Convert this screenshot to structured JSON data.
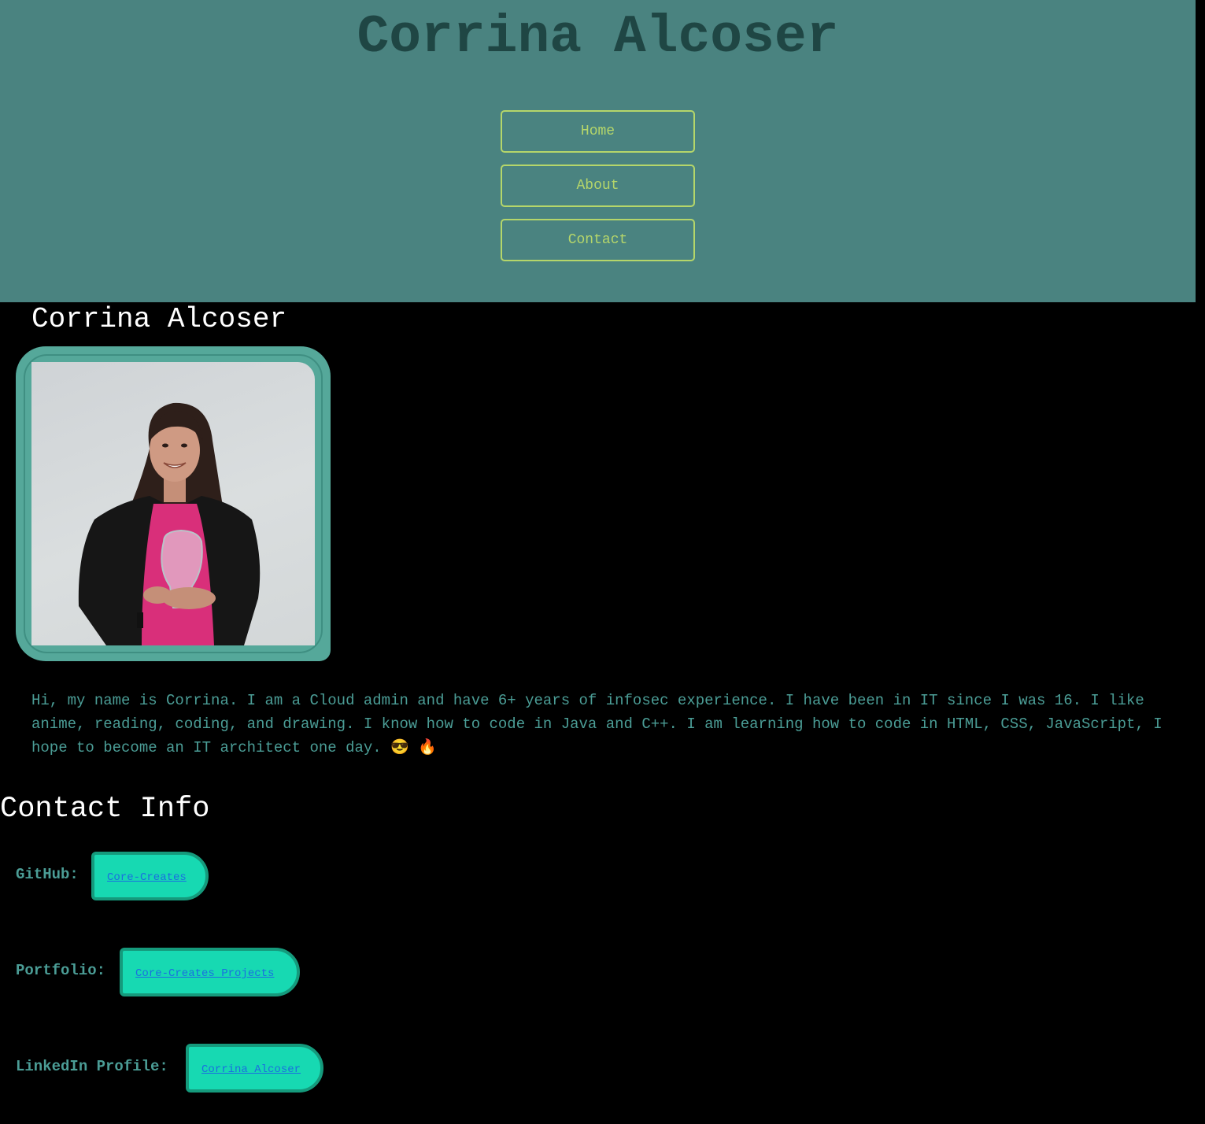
{
  "header": {
    "title": "Corrina Alcoser",
    "nav": {
      "home": "Home",
      "about": "About",
      "contact": "Contact"
    }
  },
  "profile": {
    "name": "Corrina Alcoser",
    "photo_alt": "Corrina Alcoser",
    "bio": "Hi, my name is Corrina. I am a Cloud admin and have 6+ years of infosec experience. I have been in IT since I was 16. I like anime, reading, coding, and drawing. I know how to code in Java and C++. I am learning how to code in HTML, CSS, JavaScript, I hope to become an IT architect one day. 😎 🔥"
  },
  "contact": {
    "heading": "Contact Info",
    "items": [
      {
        "label": "GitHub:",
        "link_text": "Core-Creates"
      },
      {
        "label": "Portfolio:",
        "link_text": "Core-Creates Projects"
      },
      {
        "label": "LinkedIn Profile:",
        "link_text": "Corrina Alcoser"
      }
    ]
  },
  "colors": {
    "header_bg": "#4a8380",
    "title": "#1f4644",
    "nav_accent": "#b5d66a",
    "body_text": "#4b9d96",
    "pill_bg": "#17d9b2",
    "pill_border": "#159a7c",
    "link": "#1a6fe0"
  }
}
